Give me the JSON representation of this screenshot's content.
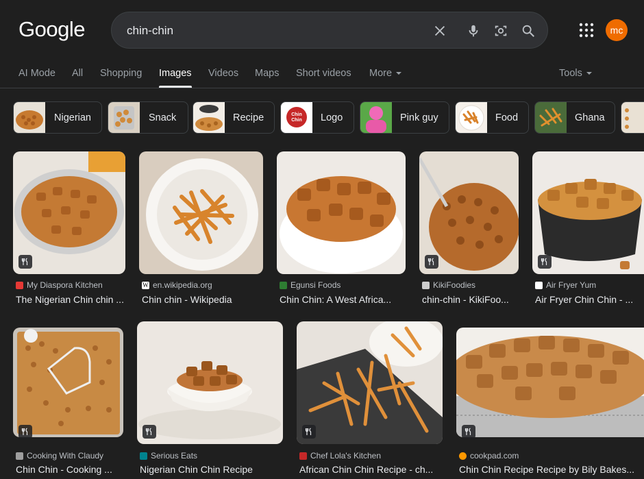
{
  "logo": "Google",
  "search": {
    "query": "chin-chin"
  },
  "avatar": {
    "initials": "mc",
    "color": "#ef6c00"
  },
  "tabs": [
    {
      "label": "AI Mode"
    },
    {
      "label": "All"
    },
    {
      "label": "Shopping"
    },
    {
      "label": "Images",
      "active": true
    },
    {
      "label": "Videos"
    },
    {
      "label": "Maps"
    },
    {
      "label": "Short videos"
    },
    {
      "label": "More"
    },
    {
      "label": "Tools"
    }
  ],
  "chips": [
    {
      "label": "Nigerian"
    },
    {
      "label": "Snack"
    },
    {
      "label": "Recipe"
    },
    {
      "label": "Logo",
      "thumb_text": "Chin Chin"
    },
    {
      "label": "Pink guy"
    },
    {
      "label": "Food"
    },
    {
      "label": "Ghana"
    }
  ],
  "results": [
    {
      "source": "My Diaspora Kitchen",
      "title": "The Nigerian Chin chin ...",
      "favicon_color": "#e53935",
      "recipe": true
    },
    {
      "source": "en.wikipedia.org",
      "title": "Chin chin - Wikipedia",
      "favicon_color": "#ffffff",
      "favicon_text": "W",
      "recipe": false
    },
    {
      "source": "Egunsi Foods",
      "title": "Chin Chin: A West Africa...",
      "favicon_color": "#2e7d32",
      "recipe": false
    },
    {
      "source": "KikiFoodies",
      "title": "chin-chin - KikiFoo...",
      "favicon_color": "#cccccc",
      "recipe": true
    },
    {
      "source": "Air Fryer Yum",
      "title": "Air Fryer Chin Chin - ...",
      "favicon_color": "#ffffff",
      "recipe": true
    },
    {
      "source": "Cooking With Claudy",
      "title": "Chin Chin - Cooking ...",
      "favicon_color": "#9e9e9e",
      "recipe": true
    },
    {
      "source": "Serious Eats",
      "title": "Nigerian Chin Chin Recipe",
      "favicon_color": "#00838f",
      "recipe": true
    },
    {
      "source": "Chef Lola's Kitchen",
      "title": "African Chin Chin Recipe - ch...",
      "favicon_color": "#c62828",
      "recipe": true
    },
    {
      "source": "cookpad.com",
      "title": "Chin Chin Recipe Recipe by Bily Bakes...",
      "favicon_color": "#ff9800",
      "recipe": true
    }
  ]
}
